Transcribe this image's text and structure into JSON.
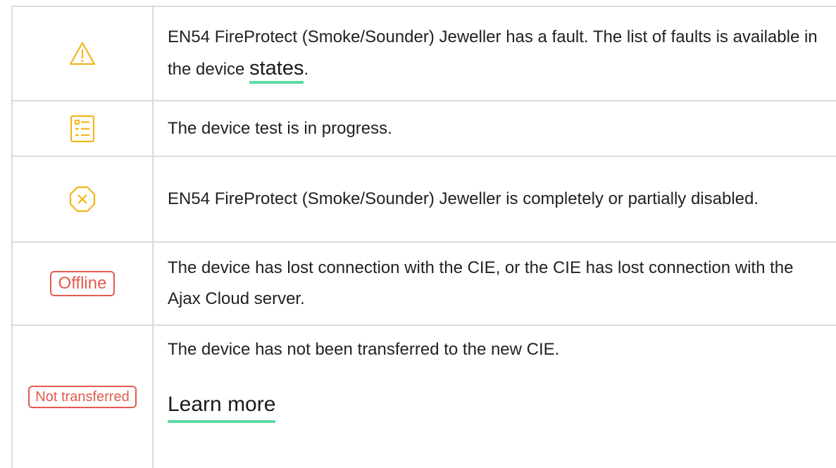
{
  "rows": [
    {
      "icon": "warning-triangle-icon",
      "text_before": "EN54 FireProtect (Smoke/Sounder) Jeweller has a fault. The list of faults is available in the device ",
      "link_text": "states",
      "text_after": "."
    },
    {
      "icon": "checklist-icon",
      "text": "The device test is in progress."
    },
    {
      "icon": "disabled-octagon-x-icon",
      "text": "EN54 FireProtect (Smoke/Sounder) Jeweller is completely or partially disabled."
    },
    {
      "badge": "Offline",
      "text": "The device has lost connection with the CIE, or the CIE has lost connection with the Ajax Cloud server."
    },
    {
      "badge": "Not transferred",
      "text": "The device has not been transferred to the new CIE.",
      "link_text": "Learn more"
    }
  ],
  "colors": {
    "icon_amber": "#f2b51a",
    "badge_red": "#e15b4f",
    "link_underline": "#5bdba0",
    "border": "#dcdcdc"
  }
}
